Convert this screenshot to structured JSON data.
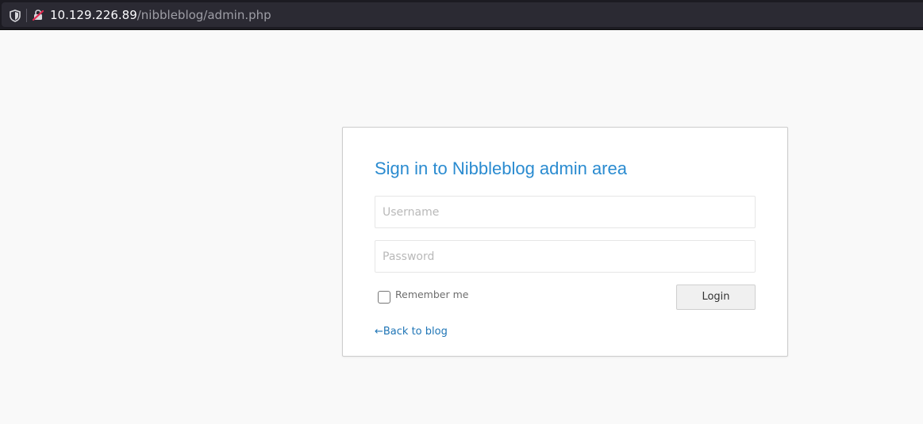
{
  "browser": {
    "url_host": "10.129.226.89",
    "url_path": "/nibbleblog/admin.php",
    "icons": [
      "shield-icon",
      "insecure-lock-icon"
    ]
  },
  "login": {
    "title": "Sign in to Nibbleblog admin area",
    "username_placeholder": "Username",
    "password_placeholder": "Password",
    "remember_label": "Remember me",
    "remember_checked": false,
    "login_button": "Login",
    "back_link": "←Back to blog"
  },
  "colors": {
    "title": "#2a8bd0",
    "link": "#1f75b6",
    "page_bg": "#f9f9f9",
    "urlbar_bg": "#1c1b22",
    "insecure_lock": "#e22850"
  }
}
